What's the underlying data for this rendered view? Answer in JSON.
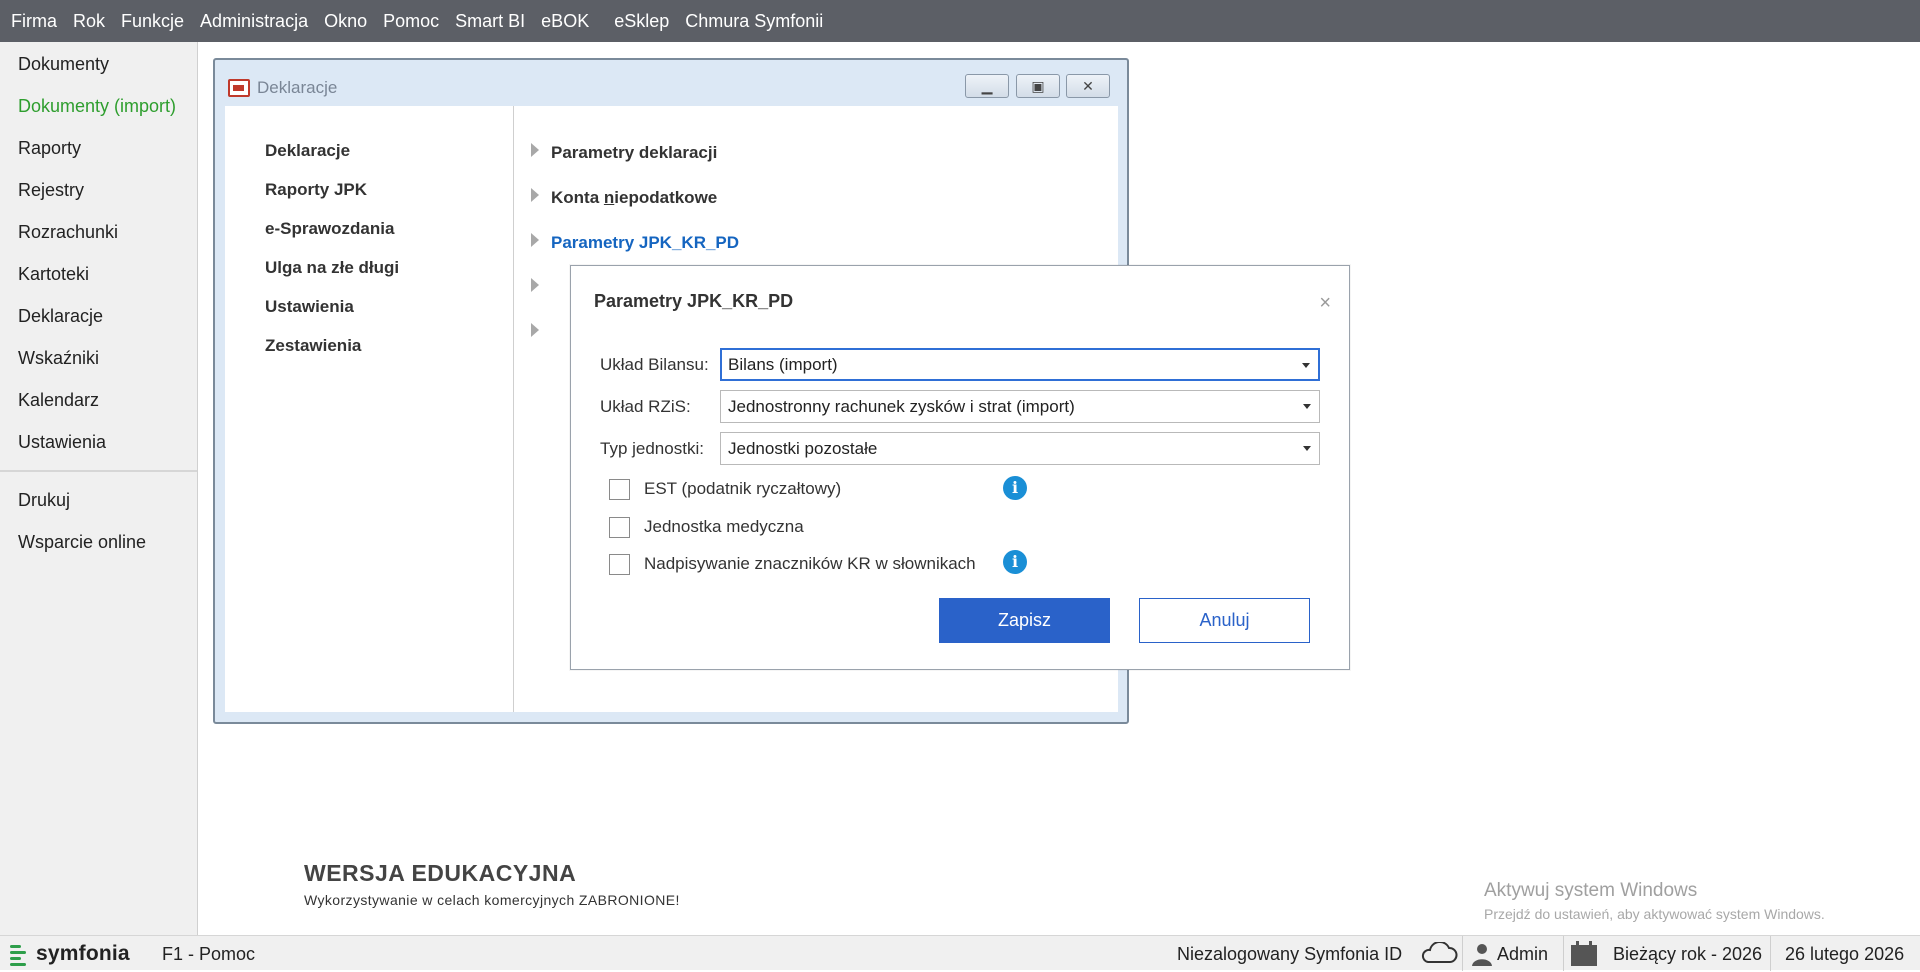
{
  "menu": [
    "Firma",
    "Rok",
    "Funkcje",
    "Administracja",
    "Okno",
    "Pomoc",
    "Smart BI",
    "eBOK",
    "eSklep",
    "Chmura Symfonii"
  ],
  "sidebar": {
    "items": [
      {
        "label": "Dokumenty"
      },
      {
        "label": "Dokumenty (import)",
        "active": true
      },
      {
        "label": "Raporty"
      },
      {
        "label": "Rejestry"
      },
      {
        "label": "Rozrachunki"
      },
      {
        "label": "Kartoteki"
      },
      {
        "label": "Deklaracje"
      },
      {
        "label": "Wskaźniki"
      },
      {
        "label": "Kalendarz"
      },
      {
        "label": "Ustawienia"
      }
    ],
    "bottom_items": [
      {
        "label": "Drukuj"
      },
      {
        "label": "Wsparcie online"
      }
    ]
  },
  "decl_window": {
    "title": "Deklaracje",
    "nav": [
      "Deklaracje",
      "Raporty JPK",
      "e-Sprawozdania",
      "Ulga na złe długi",
      "Ustawienia",
      "Zestawienia"
    ],
    "sections": [
      {
        "label": "Parametry deklaracji"
      },
      {
        "label_pre": "Konta ",
        "label_u": "n",
        "label_post": "iepodatkowe"
      },
      {
        "label": "Parametry JPK_KR_PD"
      }
    ]
  },
  "dialog": {
    "title": "Parametry JPK_KR_PD",
    "close": "×",
    "fields": [
      {
        "label": "Układ Bilansu:",
        "value": "Bilans (import)"
      },
      {
        "label": "Układ RZiS:",
        "value": "Jednostronny rachunek zysków i strat (import)"
      },
      {
        "label": "Typ jednostki:",
        "value": "Jednostki pozostałe"
      }
    ],
    "checkboxes": [
      {
        "label": "EST (podatnik ryczałtowy)",
        "checked": false,
        "info": true
      },
      {
        "label": "Jednostka medyczna",
        "checked": false,
        "info": false
      },
      {
        "label": "Nadpisywanie znaczników KR w słownikach",
        "checked": false,
        "info": true
      }
    ],
    "save": "Zapisz",
    "cancel": "Anuluj"
  },
  "watermark": {
    "title": "WERSJA EDUKACYJNA",
    "subtitle": "Wykorzystywanie w celach komercyjnych ZABRONIONE!"
  },
  "windows_activation": {
    "line1": "Aktywuj system Windows",
    "line2": "Przejdź do ustawień, aby aktywować system Windows."
  },
  "statusbar": {
    "logo": "symfonia",
    "help": "F1 - Pomoc",
    "symfonia_id": "Niezalogowany Symfonia ID",
    "user": "Admin",
    "year": "Bieżący rok - 2026",
    "date": "26 lutego 2026"
  },
  "colors": {
    "menubar": "#5c5f66",
    "accent": "#2a62c9",
    "active_sidebar": "#2e9e2e",
    "link": "#1565c0",
    "info": "#1a8fd6"
  }
}
